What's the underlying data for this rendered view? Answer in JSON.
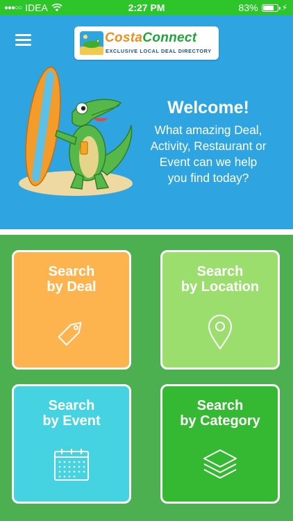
{
  "status_bar": {
    "carrier": "IDEA",
    "time": "2:27 PM",
    "battery": "83%",
    "battery_level": 0.83
  },
  "header": {
    "logo_title_part1": "Costa",
    "logo_title_part2": "Connect",
    "logo_subtitle": "EXCLUSIVE LOCAL DEAL DIRECTORY"
  },
  "welcome": {
    "title": "Welcome!",
    "lines": [
      "What amazing Deal,",
      "Activity, Restaurant or",
      "Event can we help",
      "you find today?"
    ]
  },
  "tiles": [
    {
      "line1": "Search",
      "line2": "by Deal",
      "icon": "tag-icon",
      "color": "#fdb44f"
    },
    {
      "line1": "Search",
      "line2": "by Location",
      "icon": "location-pin-icon",
      "color": "#9bde6e"
    },
    {
      "line1": "Search",
      "line2": "by Event",
      "icon": "calendar-icon",
      "color": "#45d3e2"
    },
    {
      "line1": "Search",
      "line2": "by Category",
      "icon": "layers-icon",
      "color": "#36b932"
    }
  ]
}
